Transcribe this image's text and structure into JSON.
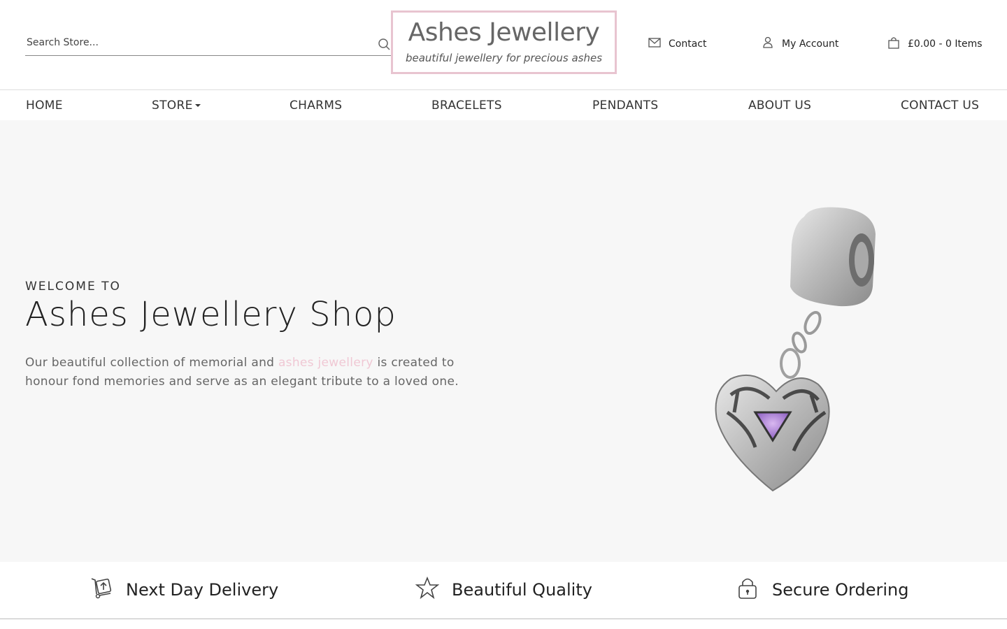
{
  "search": {
    "placeholder": "Search Store..."
  },
  "logo": {
    "title": "Ashes Jewellery",
    "subtitle": "beautiful jewellery for precious ashes"
  },
  "header_links": {
    "contact": "Contact",
    "account": "My Account",
    "cart": "£0.00 - 0 Items"
  },
  "nav": {
    "items": [
      {
        "label": "HOME"
      },
      {
        "label": "STORE"
      },
      {
        "label": "CHARMS"
      },
      {
        "label": "BRACELETS"
      },
      {
        "label": "PENDANTS"
      },
      {
        "label": "ABOUT US"
      },
      {
        "label": "CONTACT US"
      }
    ]
  },
  "hero": {
    "kicker": "WELCOME TO",
    "title": "Ashes Jewellery Shop",
    "desc_before": "Our beautiful collection of memorial and ",
    "desc_link": "ashes jewellery",
    "desc_after": " is created to honour fond memories and serve as an elegant tribute to a loved one."
  },
  "features": [
    {
      "label": "Next Day Delivery",
      "icon": "delivery-icon"
    },
    {
      "label": "Beautiful Quality",
      "icon": "star-icon"
    },
    {
      "label": "Secure Ordering",
      "icon": "lock-icon"
    }
  ],
  "colors": {
    "logo_border": "#e8c4d0",
    "highlight_text": "#f0c8d4",
    "hero_bg": "#f7f7f7"
  }
}
